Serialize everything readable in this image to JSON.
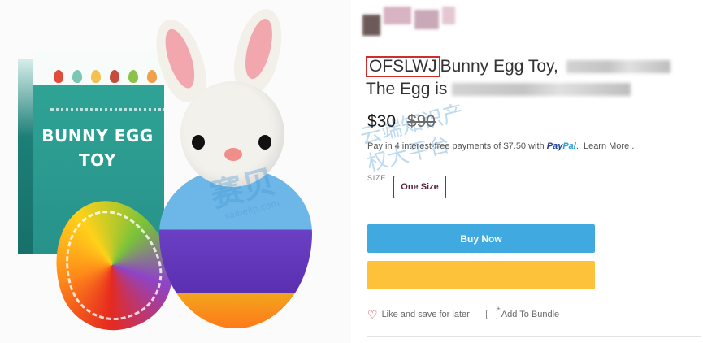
{
  "product_image": {
    "box_title": "BUNNY EGG TOY",
    "box_title_lines": [
      "BUNNY EGG",
      "TOY"
    ],
    "mini_egg_colors": [
      "#e04b3a",
      "#7bc6b4",
      "#f2c14e",
      "#c74b3c",
      "#8bc34a",
      "#f0a04b",
      "#e45a7a"
    ]
  },
  "watermark": {
    "logo": "赛贝",
    "tagline": "云端知识产权大平台",
    "url": "saibeiip.com"
  },
  "product": {
    "brand": "OFSLWJ",
    "title_part1": "Bunny Egg Toy, ",
    "title_part2": "The Egg is",
    "price_current": "$30",
    "price_original": "$90",
    "installments": "Pay in 4 interest-free payments of $7.50 with",
    "paypal_pay": "Pay",
    "paypal_pal": "Pal",
    "paypal_suffix": ".",
    "learn_more": "Learn More",
    "learn_more_suffix": " .",
    "size_label": "SIZE",
    "size_selected": "One Size",
    "buy_now": "Buy Now",
    "like_label": "Like and save for later",
    "bundle_label": "Add To Bundle"
  },
  "colors": {
    "buy_now": "#3fa9e0",
    "paypal_button": "#fdc13a",
    "brand_highlight": "#d32a2a",
    "size_border": "#8a2a57"
  },
  "icons": {
    "like": "heart-icon",
    "bundle": "bundle-add-icon"
  }
}
